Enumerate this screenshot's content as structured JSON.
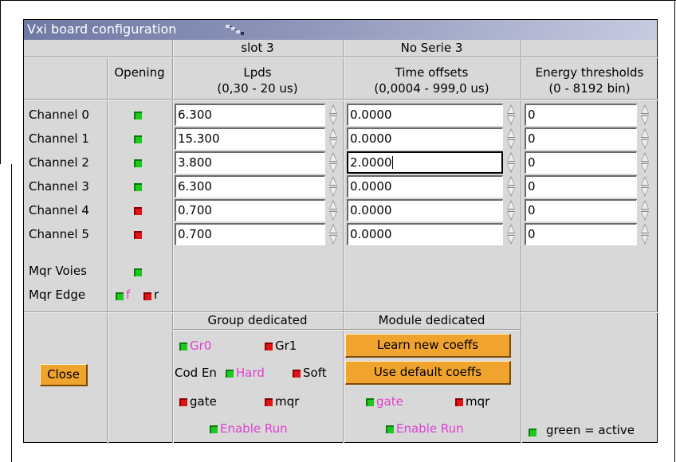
{
  "window": {
    "title": "Vxi board configuration"
  },
  "header": {
    "slot": "slot 3",
    "serial": "No Serie  3",
    "col_opening": "Opening",
    "col_lpds": "Lpds",
    "col_lpds_range": "(0,30 - 20 us)",
    "col_time": "Time offsets",
    "col_time_range": "(0,0004 -  999,0 us)",
    "col_energy": "Energy thresholds",
    "col_energy_range": "(0 - 8192 bin)"
  },
  "channels": [
    {
      "label": "Channel 0",
      "opening": "green",
      "lpds": "6.300",
      "time": "0.0000",
      "energy": "0"
    },
    {
      "label": "Channel 1",
      "opening": "green",
      "lpds": "15.300",
      "time": "0.0000",
      "energy": "0"
    },
    {
      "label": "Channel 2",
      "opening": "green",
      "lpds": "3.800",
      "time": "2.0000",
      "energy": "0"
    },
    {
      "label": "Channel 3",
      "opening": "green",
      "lpds": "6.300",
      "time": "0.0000",
      "energy": "0"
    },
    {
      "label": "Channel 4",
      "opening": "red",
      "lpds": "0.700",
      "time": "0.0000",
      "energy": "0"
    },
    {
      "label": "Channel 5",
      "opening": "red",
      "lpds": "0.700",
      "time": "0.0000",
      "energy": "0"
    }
  ],
  "mqr_voies": {
    "label": "Mqr Voies",
    "state": "green"
  },
  "mqr_edge": {
    "label": "Mqr Edge",
    "f_label": "f",
    "r_label": "r",
    "f_state": "green",
    "r_state": "red"
  },
  "group": {
    "title": "Group  dedicated",
    "gr0": "Gr0",
    "gr1": "Gr1",
    "cod_label": "Cod En",
    "hard": "Hard",
    "soft": "Soft",
    "gate": "gate",
    "mqr": "mqr",
    "enable_run": "Enable Run"
  },
  "module": {
    "title": "Module dedicated",
    "learn": "Learn new coeffs",
    "use_default": "Use default coeffs",
    "gate": "gate",
    "mqr": "mqr",
    "enable_run": "Enable Run"
  },
  "close_label": "Close",
  "legend": {
    "text": "green = active",
    "state": "green"
  },
  "colors": {
    "green_led": "#1ec81e",
    "red_led": "#e01414",
    "button": "#f0a32d",
    "pink_text": "#e040d0",
    "title_bar": "#7f89b0"
  }
}
